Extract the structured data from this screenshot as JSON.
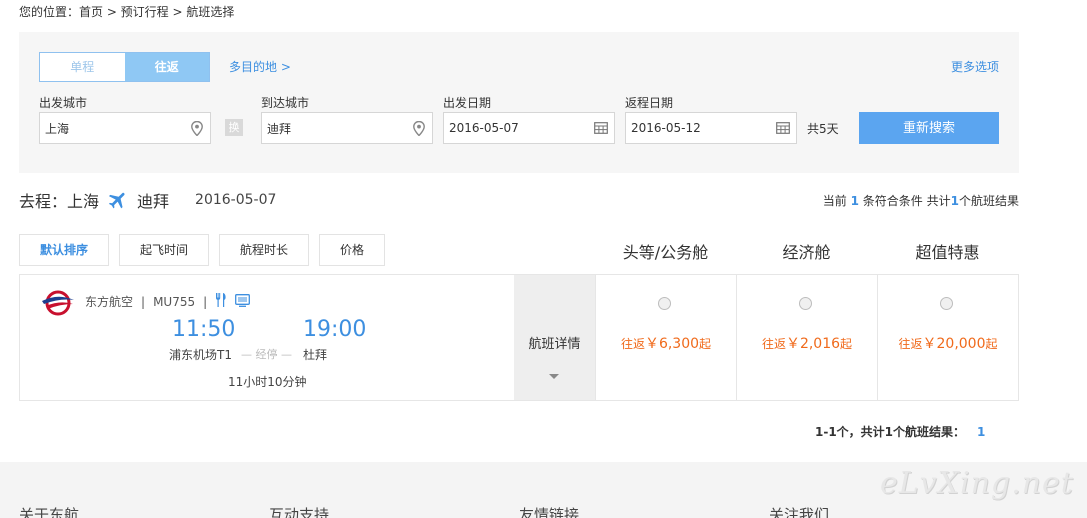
{
  "breadcrumb": "您的位置：首页 > 预订行程 > 航班选择",
  "search": {
    "trip_types": [
      "单程",
      "往返"
    ],
    "multi_dest": "多目的地 >",
    "more_options": "更多选项",
    "from_label": "出发城市",
    "from_value": "上海",
    "swap_label": "换",
    "to_label": "到达城市",
    "to_value": "迪拜",
    "depart_label": "出发日期",
    "depart_value": "2016-05-07",
    "return_label": "返程日期",
    "return_value": "2016-05-12",
    "days": "共5天",
    "button": "重新搜索"
  },
  "route": {
    "prefix": "去程：上海",
    "dest": "迪拜",
    "date": "2016-05-07",
    "count_a": "当前",
    "count_n": "1",
    "count_b": "条符合条件 共计",
    "count_total": "1",
    "count_c": "个航班结果"
  },
  "sort": [
    "默认排序",
    "起飞时间",
    "航程时长",
    "价格"
  ],
  "cabins": [
    "头等/公务舱",
    "经济舱",
    "超值特惠"
  ],
  "flight": {
    "airline": "东方航空",
    "sep": "|",
    "number": "MU755",
    "depart_time": "11:50",
    "arrive_time": "19:00",
    "depart_airport": "浦东机场T1",
    "stop": "— 经停 —",
    "arrive_airport": "杜拜",
    "duration": "11小时10分钟",
    "detail_label": "航班详情",
    "prices": [
      {
        "prefix": "往返",
        "amount": "￥6,300",
        "suffix": "起"
      },
      {
        "prefix": "往返",
        "amount": "￥2,016",
        "suffix": "起"
      },
      {
        "prefix": "往返",
        "amount": "￥20,000",
        "suffix": "起"
      }
    ]
  },
  "pager": {
    "text": "1-1个，共计1个航班结果：",
    "page": "1"
  },
  "footer": [
    "关于东航",
    "互动支持",
    "友情链接",
    "关注我们"
  ],
  "watermark": "eLvXing.net",
  "colors": {
    "accent": "#3d8fe0",
    "button": "#5ba5f0",
    "price": "#f06a1b"
  }
}
